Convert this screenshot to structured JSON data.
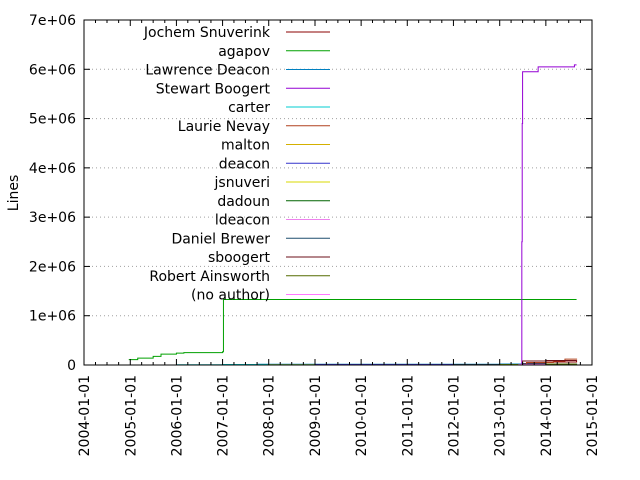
{
  "chart_data": {
    "type": "line",
    "title": "",
    "xlabel": "",
    "ylabel": "Lines",
    "x_axis_type": "date",
    "xlim": [
      "2004-01-01",
      "2015-01-01"
    ],
    "ylim": [
      0,
      7000000
    ],
    "grid": true,
    "legend_position": "top-left",
    "x_ticks": [
      "2004-01-01",
      "2005-01-01",
      "2006-01-01",
      "2007-01-01",
      "2008-01-01",
      "2009-01-01",
      "2010-01-01",
      "2011-01-01",
      "2012-01-01",
      "2013-01-01",
      "2014-01-01",
      "2015-01-01"
    ],
    "y_ticks": [
      {
        "value": 0,
        "label": "0"
      },
      {
        "value": 1000000,
        "label": "1e+06"
      },
      {
        "value": 2000000,
        "label": "2e+06"
      },
      {
        "value": 3000000,
        "label": "3e+06"
      },
      {
        "value": 4000000,
        "label": "4e+06"
      },
      {
        "value": 5000000,
        "label": "5e+06"
      },
      {
        "value": 6000000,
        "label": "6e+06"
      },
      {
        "value": 7000000,
        "label": "7e+06"
      }
    ],
    "series": [
      {
        "name": "Jochem Snuverink",
        "color": "#8b0000",
        "step": true,
        "points": [
          [
            "2013-05-01",
            0
          ],
          [
            "2013-07-01",
            30000
          ],
          [
            "2014-01-01",
            60000
          ],
          [
            "2014-09-01",
            80000
          ]
        ]
      },
      {
        "name": "agapov",
        "color": "#00a000",
        "step": true,
        "points": [
          [
            "2004-12-20",
            110000
          ],
          [
            "2005-03-01",
            140000
          ],
          [
            "2005-07-01",
            175000
          ],
          [
            "2005-09-01",
            220000
          ],
          [
            "2006-01-01",
            240000
          ],
          [
            "2006-03-01",
            250000
          ],
          [
            "2007-01-01",
            270000
          ],
          [
            "2007-01-08",
            1330000
          ],
          [
            "2014-09-01",
            1330000
          ]
        ]
      },
      {
        "name": "Lawrence Deacon",
        "color": "#0080c0",
        "step": true,
        "points": [
          [
            "2006-01-01",
            0
          ],
          [
            "2007-01-01",
            10000
          ],
          [
            "2007-10-01",
            15000
          ],
          [
            "2013-01-01",
            20000
          ],
          [
            "2014-09-01",
            30000
          ]
        ]
      },
      {
        "name": "Stewart Boogert",
        "color": "#9400d3",
        "step": true,
        "points": [
          [
            "2013-06-20",
            0
          ],
          [
            "2013-06-25",
            2500000
          ],
          [
            "2013-06-28",
            4900000
          ],
          [
            "2013-07-01",
            5950000
          ],
          [
            "2013-10-01",
            5950000
          ],
          [
            "2013-11-01",
            6050000
          ],
          [
            "2014-07-01",
            6050000
          ],
          [
            "2014-08-15",
            6090000
          ],
          [
            "2014-09-01",
            6090000
          ]
        ]
      },
      {
        "name": "carter",
        "color": "#00ced1",
        "step": true,
        "points": [
          [
            "2006-01-01",
            5000
          ],
          [
            "2007-01-01",
            10000
          ],
          [
            "2014-09-01",
            10000
          ]
        ]
      },
      {
        "name": "Laurie Nevay",
        "color": "#b0411e",
        "step": true,
        "points": [
          [
            "2013-07-01",
            0
          ],
          [
            "2013-08-01",
            50000
          ],
          [
            "2014-03-01",
            80000
          ],
          [
            "2014-06-01",
            120000
          ],
          [
            "2014-09-01",
            130000
          ]
        ]
      },
      {
        "name": "malton",
        "color": "#d4b000",
        "step": true,
        "points": [
          [
            "2007-01-01",
            0
          ],
          [
            "2008-01-01",
            5000
          ],
          [
            "2014-09-01",
            5000
          ]
        ]
      },
      {
        "name": "deacon",
        "color": "#3333cc",
        "step": true,
        "points": [
          [
            "2008-01-01",
            0
          ],
          [
            "2009-01-01",
            10000
          ],
          [
            "2014-09-01",
            10000
          ]
        ]
      },
      {
        "name": "jsnuveri",
        "color": "#d8d800",
        "step": true,
        "points": [
          [
            "2012-06-01",
            0
          ],
          [
            "2013-01-01",
            10000
          ],
          [
            "2014-09-01",
            10000
          ]
        ]
      },
      {
        "name": "dadoun",
        "color": "#006400",
        "step": true,
        "points": [
          [
            "2011-01-01",
            0
          ],
          [
            "2012-01-01",
            5000
          ],
          [
            "2014-09-01",
            5000
          ]
        ]
      },
      {
        "name": "ldeacon",
        "color": "#ee82ee",
        "step": true,
        "points": [
          [
            "2013-01-01",
            0
          ],
          [
            "2013-06-01",
            10000
          ],
          [
            "2014-09-01",
            10000
          ]
        ]
      },
      {
        "name": "Daniel Brewer",
        "color": "#1f4f6f",
        "step": true,
        "points": [
          [
            "2014-01-01",
            0
          ],
          [
            "2014-06-01",
            5000
          ],
          [
            "2014-09-01",
            5000
          ]
        ]
      },
      {
        "name": "sboogert",
        "color": "#6b0f1a",
        "step": true,
        "points": [
          [
            "2013-06-01",
            0
          ],
          [
            "2013-07-01",
            80000
          ],
          [
            "2014-01-01",
            90000
          ],
          [
            "2014-09-01",
            100000
          ]
        ]
      },
      {
        "name": "Robert Ainsworth",
        "color": "#556b00",
        "step": true,
        "points": [
          [
            "2013-01-01",
            0
          ],
          [
            "2014-01-01",
            20000
          ],
          [
            "2014-09-01",
            25000
          ]
        ]
      },
      {
        "name": "(no author)",
        "color": "#ff77ff",
        "step": true,
        "points": [
          [
            "2007-01-01",
            0
          ],
          [
            "2007-02-01",
            1000
          ],
          [
            "2014-09-01",
            1000
          ]
        ]
      }
    ]
  }
}
